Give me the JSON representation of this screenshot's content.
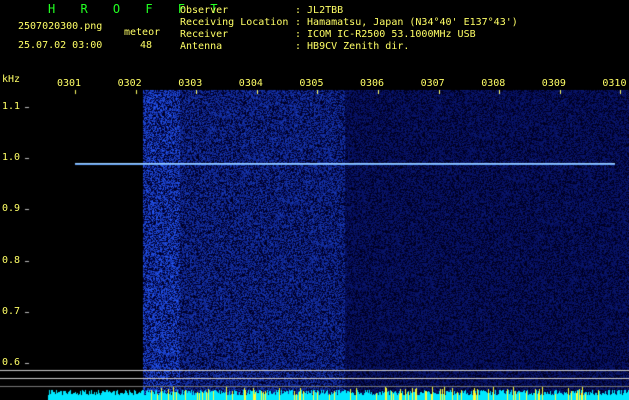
{
  "header": {
    "logo": "H R O F F T",
    "filename": "2507020300.png",
    "datetime": "25.07.02 03:00",
    "meteor_label": "meteor",
    "meteor_count": "48",
    "observer_label": "Observer",
    "location_label": "Receiving Location",
    "receiver_label": "Receiver",
    "antenna_label": "Antenna",
    "observer_value": ": JL2TBB",
    "location_value": ": Hamamatsu, Japan (N34°40' E137°43')",
    "receiver_value": ": ICOM IC-R2500 53.1000MHz USB",
    "antenna_value": ": HB9CV Zenith dir."
  },
  "chart_data": {
    "type": "heatmap",
    "title": "",
    "xlabel": "",
    "ylabel": "kHz",
    "x_ticks": [
      "0301",
      "0302",
      "0303",
      "0304",
      "0305",
      "0306",
      "0307",
      "0308",
      "0309",
      "0310"
    ],
    "y_ticks": [
      "1.1",
      "1.0",
      "0.9",
      "0.8",
      "0.7",
      "0.6"
    ],
    "ylim": [
      0.55,
      1.15
    ],
    "carrier_frequency_khz": 0.96,
    "colors": {
      "background": "#000000",
      "noise": "#1a2bd8",
      "carrier": "#6aa8ff",
      "text": "#ffff66",
      "logo": "#22ff22"
    }
  }
}
